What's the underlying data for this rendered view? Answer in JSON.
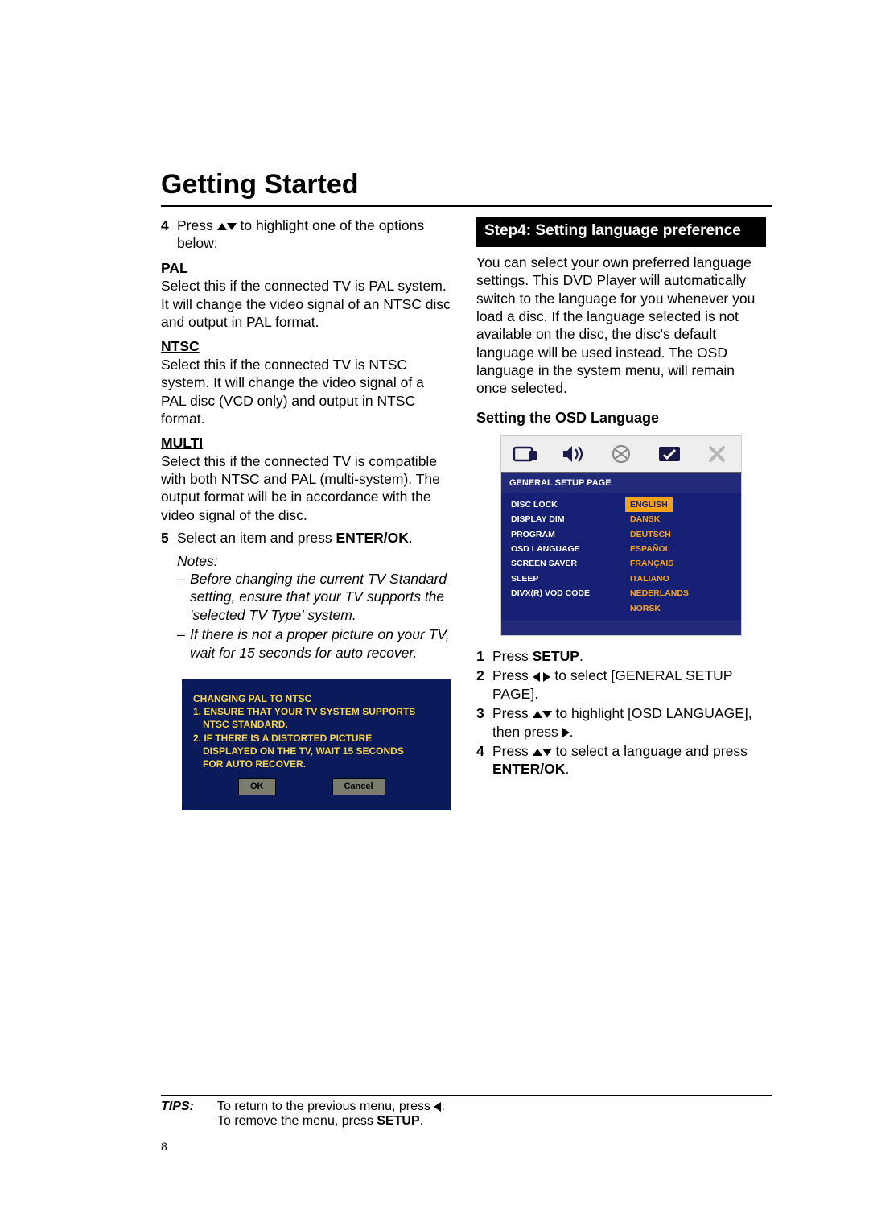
{
  "title": "Getting Started",
  "left": {
    "step4": {
      "num": "4",
      "text_a": "Press ",
      "text_b": " to highlight one of the options below:"
    },
    "pal_head": "PAL",
    "pal_body": "Select this if the connected TV is PAL system. It will change the video signal of an NTSC disc and output in PAL format.",
    "ntsc_head": "NTSC",
    "ntsc_body": "Select this if the connected TV is NTSC system. It will change the video signal of a PAL disc (VCD only) and output in NTSC format.",
    "multi_head": "MULTI",
    "multi_body": "Select this if the connected TV is compatible with both NTSC and PAL (multi-system). The output format will be in accordance with the video signal of the disc.",
    "step5": {
      "num": "5",
      "text_a": "Select an item and press ",
      "bold": "ENTER/OK",
      "text_b": "."
    },
    "notes_label": "Notes:",
    "note1": "Before changing the current TV Standard setting, ensure that your TV supports the 'selected TV Type' system.",
    "note2": "If there is not a proper picture on your TV, wait for 15 seconds for auto recover.",
    "warn": {
      "line1": "CHANGING PAL TO NTSC",
      "line2": "1. ENSURE THAT YOUR TV SYSTEM SUPPORTS",
      "line2b": "NTSC STANDARD.",
      "line3": "2. IF THERE IS A DISTORTED PICTURE",
      "line3b": "DISPLAYED ON THE TV, WAIT 15 SECONDS",
      "line3c": "FOR AUTO RECOVER.",
      "ok": "OK",
      "cancel": "Cancel"
    }
  },
  "right": {
    "blackbar": "Step4: Setting language preference",
    "intro": "You can select your own preferred language settings. This DVD Player will automatically switch to the language for you whenever you load a disc. If the language selected is not available on the disc, the disc's default language will be used instead. The OSD language in the system menu, will remain once selected.",
    "subsection": "Setting the OSD Language",
    "osd": {
      "band": "GENERAL SETUP PAGE",
      "left_items": [
        "DISC LOCK",
        "DISPLAY DIM",
        "PROGRAM",
        "OSD LANGUAGE",
        "SCREEN SAVER",
        "SLEEP",
        "DIVX(R) VOD CODE"
      ],
      "right_items": [
        "ENGLISH",
        "DANSK",
        "DEUTSCH",
        "ESPAÑOL",
        "FRANÇAIS",
        "ITALIANO",
        "NEDERLANDS",
        "NORSK"
      ]
    },
    "s1": {
      "num": "1",
      "a": "Press ",
      "b": "SETUP",
      "c": "."
    },
    "s2": {
      "num": "2",
      "a": "Press ",
      "b": " to select [GENERAL SETUP PAGE]."
    },
    "s3": {
      "num": "3",
      "a": "Press ",
      "b": " to highlight [OSD LANGUAGE], then press ",
      "c": "."
    },
    "s4": {
      "num": "4",
      "a": "Press ",
      "b": " to select a language and press ",
      "c": "ENTER/OK",
      "d": "."
    }
  },
  "tips": {
    "label": "TIPS:",
    "line1a": "To return to the previous menu, press ",
    "line1b": ".",
    "line2a": "To remove the menu, press ",
    "line2b": "SETUP",
    "line2c": "."
  },
  "page_number": "8"
}
